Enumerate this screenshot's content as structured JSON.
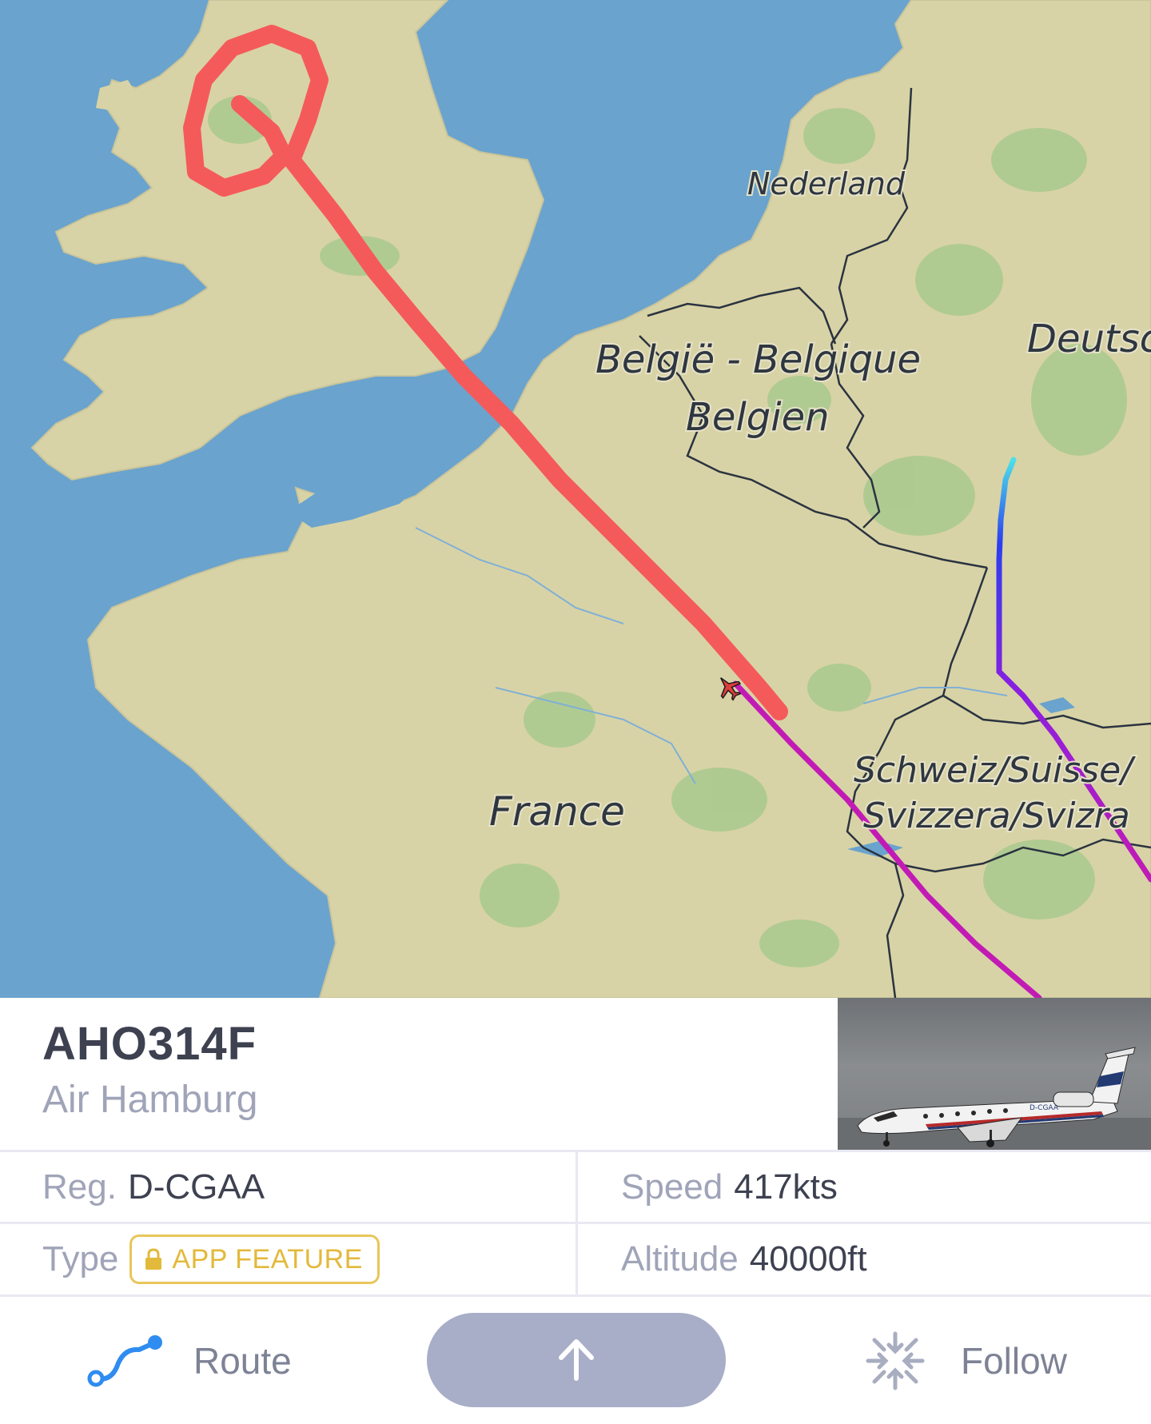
{
  "map": {
    "labels": {
      "nederland": "Nederland",
      "belgie_line1": "België - Belgique",
      "belgie_line2": "Belgien",
      "deutschland": "Deutsc",
      "schweiz_line1": "Schweiz/Suisse/",
      "schweiz_line2": "Svizzera/Svizra",
      "france": "France"
    },
    "colors": {
      "sea": "#6aa3cd",
      "land": "#d8d3a6",
      "forest": "#a9c98e",
      "annotation": "#f55a5a",
      "track_magenta": "#c21bb5",
      "track_gradient_start": "#4de0e8",
      "track_gradient_mid": "#2b3ef2"
    },
    "icons": [
      "aircraft-marker-icon"
    ]
  },
  "flight": {
    "callsign": "AHO314F",
    "airline": "Air Hamburg",
    "reg_label": "Reg.",
    "reg_value": "D-CGAA",
    "speed_label": "Speed",
    "speed_value": "417kts",
    "type_label": "Type",
    "type_badge": "APP FEATURE",
    "altitude_label": "Altitude",
    "altitude_value": "40000ft",
    "photo_reg_text": "D-CGAA"
  },
  "actions": {
    "route_label": "Route",
    "follow_label": "Follow",
    "center_icon": "arrow-up-icon"
  }
}
